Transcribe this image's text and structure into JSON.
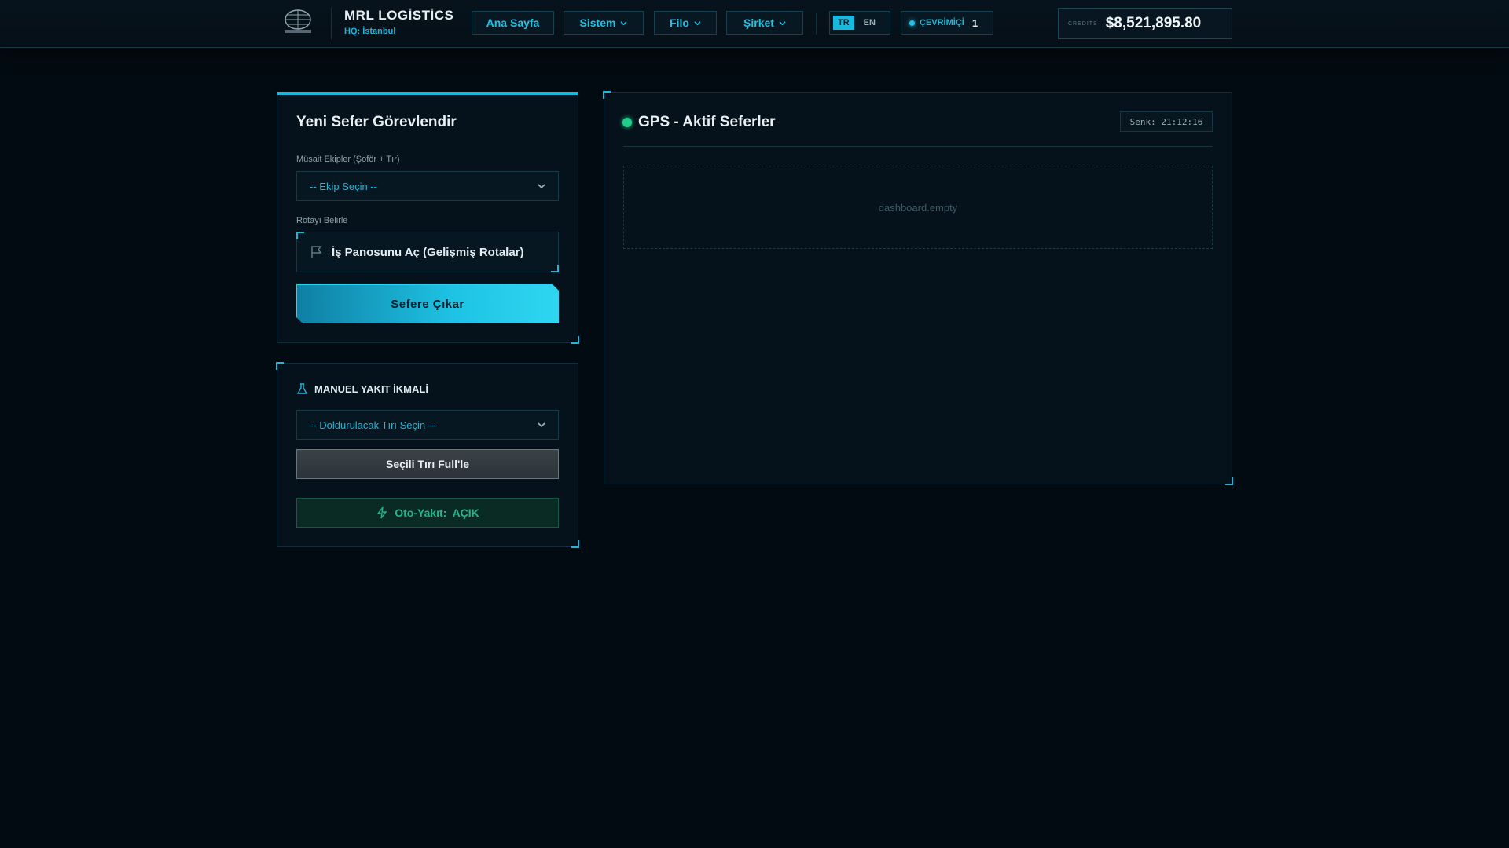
{
  "header": {
    "brand_name": "MRL LOGİSTİCS",
    "hq": "HQ: İstanbul",
    "nav": [
      {
        "label": "Ana Sayfa"
      },
      {
        "label": "Sistem"
      },
      {
        "label": "Filo"
      },
      {
        "label": "Şirket"
      }
    ],
    "lang": {
      "tr": "TR",
      "en": "EN",
      "active": "TR"
    },
    "online_label": "ÇEVRİMİÇİ",
    "online_count": "1",
    "credits_label": "CREDITS",
    "credits_value": "$8,521,895.80"
  },
  "dispatch": {
    "title": "Yeni Sefer Görevlendir",
    "crew_label": "Müsait Ekipler (Şoför + Tır)",
    "crew_select": "-- Ekip Seçin --",
    "route_label": "Rotayı Belirle",
    "route_button": "İş Panosunu Aç (Gelişmiş Rotalar)",
    "submit": "Sefere Çıkar"
  },
  "fuel": {
    "title": "MANUEL YAKIT İKMALİ",
    "truck_select": "-- Doldurulacak Tırı Seçin --",
    "fill_button": "Seçili Tırı Full'le",
    "auto_fuel": "Oto-Yakıt:  AÇIK"
  },
  "gps": {
    "title": "GPS - Aktif Seferler",
    "sync": "Senk: 21:12:16",
    "empty": "dashboard.empty"
  },
  "colors": {
    "accent": "#1fb6d8",
    "background": "#030b12",
    "status_green": "#1fcf8a"
  }
}
